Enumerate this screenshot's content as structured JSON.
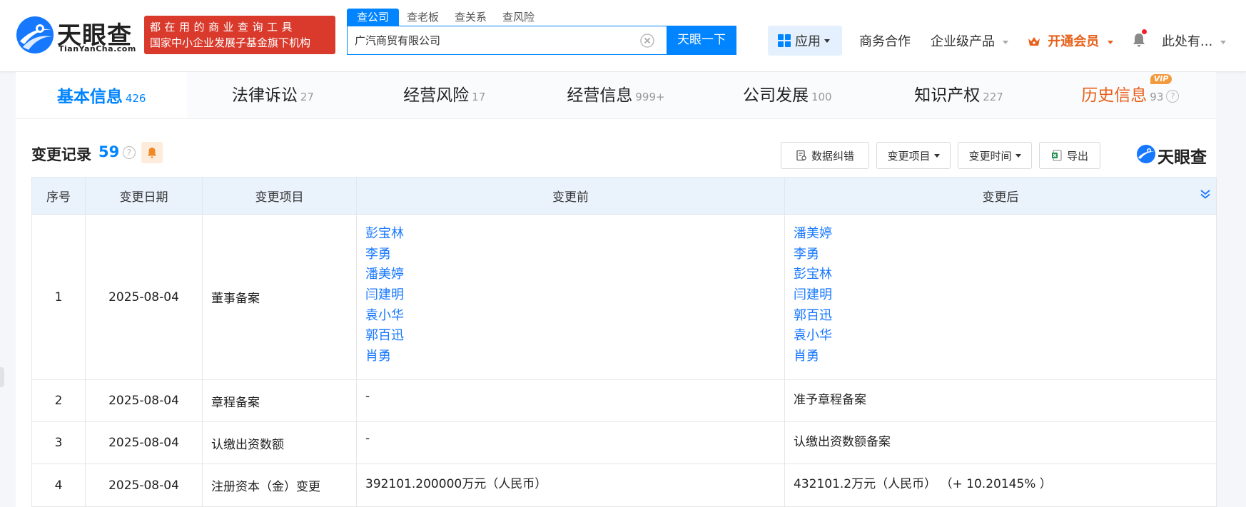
{
  "header": {
    "logo_cn": "天眼查",
    "logo_en": "TianYanCha.com",
    "slogan_line1": "都在用的商业查询工具",
    "slogan_line2": "国家中小企业发展子基金旗下机构",
    "search_tabs": [
      "查公司",
      "查老板",
      "查关系",
      "查风险"
    ],
    "search_value": "广汽商贸有限公司",
    "search_button": "天眼一下",
    "apps_label": "应用",
    "nav": {
      "business": "商务合作",
      "enterprise": "企业级产品",
      "vip": "开通会员",
      "user": "此处有..."
    }
  },
  "tabs": [
    {
      "label": "基本信息",
      "count": "426"
    },
    {
      "label": "法律诉讼",
      "count": "27"
    },
    {
      "label": "经营风险",
      "count": "17"
    },
    {
      "label": "经营信息",
      "count": "999+"
    },
    {
      "label": "公司发展",
      "count": "100"
    },
    {
      "label": "知识产权",
      "count": "227"
    },
    {
      "label": "历史信息",
      "count": "93",
      "badge": "VIP"
    }
  ],
  "section": {
    "title": "变更记录",
    "count": "59",
    "tools": {
      "correct": "数据纠错",
      "item_filter": "变更项目",
      "time_filter": "变更时间",
      "export": "导出"
    },
    "brand": "天眼查"
  },
  "table": {
    "headers": [
      "序号",
      "变更日期",
      "变更项目",
      "变更前",
      "变更后"
    ],
    "rows": [
      {
        "no": "1",
        "date": "2025-08-04",
        "item": "董事备案",
        "before": [
          "彭宝林",
          "李勇",
          "潘美婷",
          "闫建明",
          "袁小华",
          "郭百迅",
          "肖勇"
        ],
        "after": [
          "潘美婷",
          "李勇",
          "彭宝林",
          "闫建明",
          "郭百迅",
          "袁小华",
          "肖勇"
        ]
      },
      {
        "no": "2",
        "date": "2025-08-04",
        "item": "章程备案",
        "before": "-",
        "after": "准予章程备案"
      },
      {
        "no": "3",
        "date": "2025-08-04",
        "item": "认缴出资数额",
        "before": "-",
        "after": "认缴出资数额备案"
      },
      {
        "no": "4",
        "date": "2025-08-04",
        "item": "注册资本（金）变更",
        "before": "392101.200000万元（人民币）",
        "after": "432101.2万元（人民币）  （+ 10.20145% ）"
      }
    ]
  },
  "colors": {
    "primary": "#0084ff",
    "vip": "#e8601a",
    "highlight_red": "#e8432e",
    "slogan_bg": "#d93a2c"
  }
}
